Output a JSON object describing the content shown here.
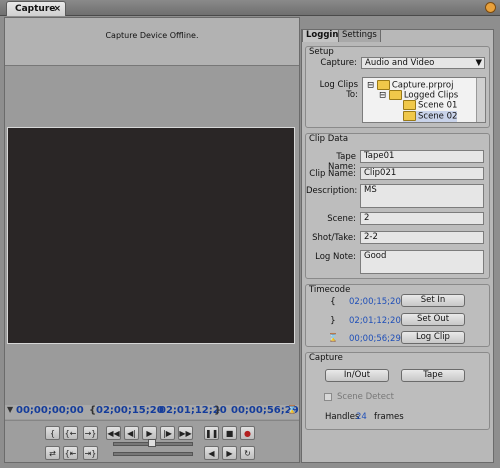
{
  "window": {
    "tab_label": "Capture",
    "close_glyph": "×"
  },
  "monitor": {
    "status_text": "Capture Device Offline.",
    "timecodes": {
      "current": "00;00;00;00",
      "in": "02;00;15;20",
      "out": "02;01;12;20",
      "duration": "00;00;56;29"
    }
  },
  "side_tabs": [
    "Logging",
    "Settings"
  ],
  "setup": {
    "title": "Setup",
    "capture_label": "Capture:",
    "capture_value": "Audio and Video",
    "log_clips_label": "Log Clips To:",
    "tree": [
      "Capture.prproj",
      "Logged Clips",
      "Scene 01",
      "Scene 02"
    ]
  },
  "clip_data": {
    "title": "Clip Data",
    "tape_name_label": "Tape Name:",
    "tape_name": "Tape01",
    "clip_name_label": "Clip Name:",
    "clip_name": "Clip021",
    "description_label": "Description:",
    "description": "MS",
    "scene_label": "Scene:",
    "scene": "2",
    "shot_label": "Shot/Take:",
    "shot": "2-2",
    "log_note_label": "Log Note:",
    "log_note": "Good"
  },
  "timecode": {
    "title": "Timecode",
    "in_value": "02;00;15;20",
    "out_value": "02;01;12;20",
    "duration_value": "00;00;56;29",
    "set_in": "Set In",
    "set_out": "Set Out",
    "log_clip": "Log Clip"
  },
  "capture": {
    "title": "Capture",
    "in_out": "In/Out",
    "tape": "Tape",
    "scene_detect": "Scene Detect",
    "handles_label": "Handles",
    "handles_value": "24",
    "frames_label": "frames"
  }
}
